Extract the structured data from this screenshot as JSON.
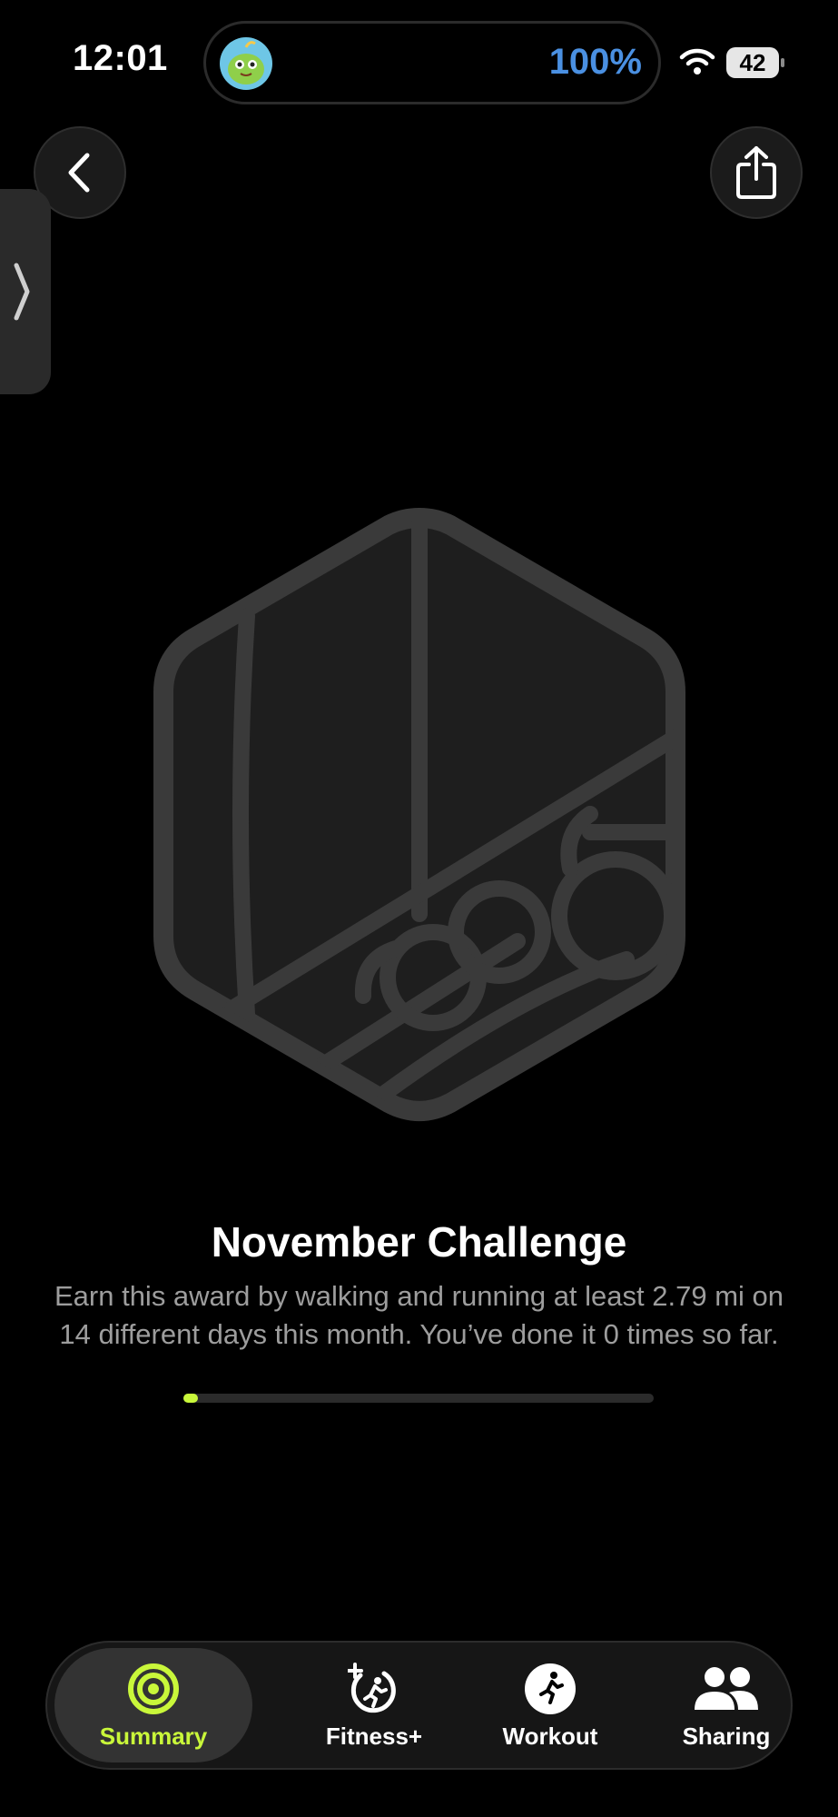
{
  "status_bar": {
    "time": "12:01",
    "battery_percent_label": "100%",
    "battery_level": "42"
  },
  "award": {
    "title": "November Challenge",
    "description": "Earn this award by walking and running at least 2.79 mi on 14 different days this month. You’ve done it 0 times so far.",
    "progress": 0.03
  },
  "tabs": [
    {
      "label": "Summary",
      "icon": "activity-rings-icon",
      "active": true
    },
    {
      "label": "Fitness+",
      "icon": "fitness-plus-icon",
      "active": false
    },
    {
      "label": "Workout",
      "icon": "running-figure-icon",
      "active": false
    },
    {
      "label": "Sharing",
      "icon": "people-icon",
      "active": false
    }
  ],
  "colors": {
    "accent": "#c9f73a",
    "battery_text": "#4a90e2",
    "background": "#000000"
  }
}
